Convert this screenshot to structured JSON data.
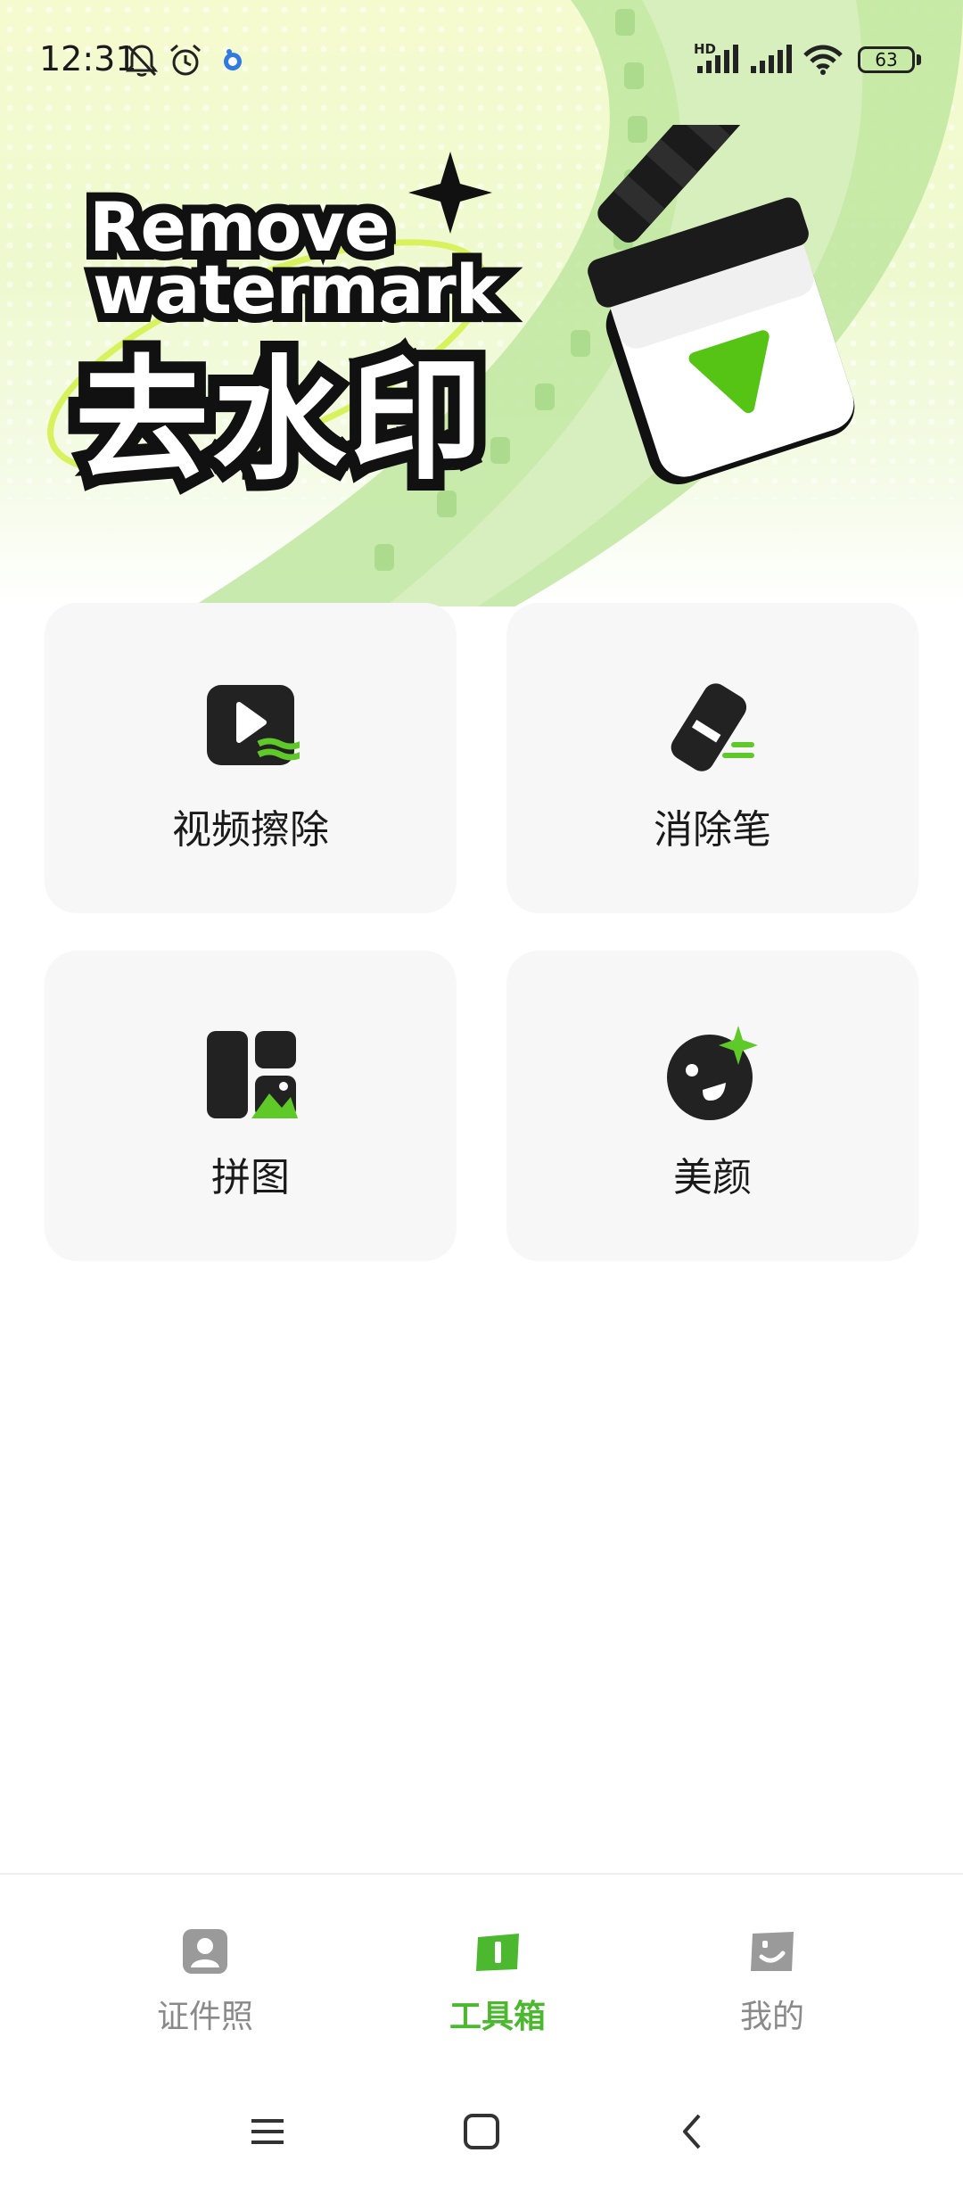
{
  "status_bar": {
    "time": "12:31",
    "network_badge": "HD",
    "battery_level": "63",
    "icons": [
      "bell-off-icon",
      "alarm-icon",
      "app-notification-icon",
      "signal-icon",
      "signal-icon",
      "wifi-icon",
      "battery-icon"
    ]
  },
  "banner": {
    "line1": "Remove",
    "line2": "watermark",
    "title_cn": "去水印",
    "graphic": "clapperboard-icon"
  },
  "tools": [
    {
      "label": "视频擦除",
      "icon": "video-erase-icon"
    },
    {
      "label": "消除笔",
      "icon": "eraser-pen-icon"
    },
    {
      "label": "拼图",
      "icon": "collage-icon"
    },
    {
      "label": "美颜",
      "icon": "beauty-face-icon"
    }
  ],
  "tabbar": {
    "tabs": [
      {
        "label": "证件照",
        "icon": "id-photo-icon",
        "active": false
      },
      {
        "label": "工具箱",
        "icon": "toolbox-icon",
        "active": true
      },
      {
        "label": "我的",
        "icon": "profile-icon",
        "active": false
      }
    ]
  },
  "colors": {
    "accent_green": "#4cb82f",
    "icon_dark": "#222222",
    "card_bg": "#f7f7f7",
    "inactive_gray": "#8a8a8a"
  }
}
